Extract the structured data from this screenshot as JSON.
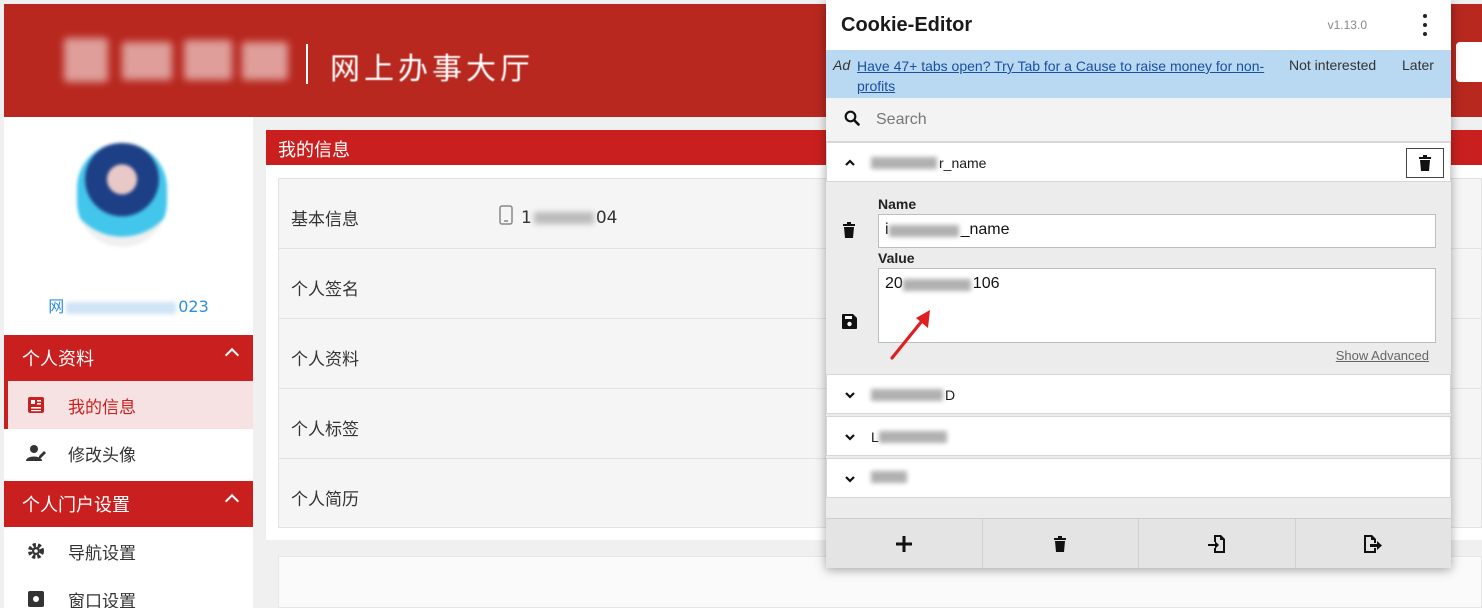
{
  "site": {
    "title": "网上办事大厅",
    "username_prefix": "网",
    "username_suffix": "023",
    "sidebar": {
      "group1": "个人资料",
      "item_my_info": "我的信息",
      "item_avatar": "修改头像",
      "group2": "个人门户设置",
      "item_nav": "导航设置",
      "item_window": "窗口设置"
    },
    "panel_title": "我的信息",
    "rows": {
      "basic": "基本信息",
      "phone_prefix": "1",
      "phone_suffix": "04",
      "signature": "个人签名",
      "profile": "个人资料",
      "tags": "个人标签",
      "resume": "个人简历"
    }
  },
  "cookie_editor": {
    "title": "Cookie-Editor",
    "version": "v1.13.0",
    "ad": {
      "tag": "Ad",
      "link": "Have 47+ tabs open? Try Tab for a Cause to raise money for non-profits",
      "not_interested": "Not interested",
      "later": "Later"
    },
    "search_placeholder": "Search",
    "expanded_cookie": {
      "row_name_suffix": "r_name",
      "name_label": "Name",
      "name_prefix": "i",
      "name_suffix": "_name",
      "value_label": "Value",
      "value_prefix": "20",
      "value_suffix": "106",
      "show_advanced": "Show Advanced"
    },
    "collapsed_cookies": [
      {
        "name_suffix": "D"
      },
      {
        "name_prefix": "L"
      },
      {
        "name_suffix": ""
      }
    ],
    "icons": {
      "search": "search-icon",
      "trash": "trash-icon",
      "save": "save-icon",
      "add": "add-icon",
      "import": "import-icon",
      "export": "export-icon"
    },
    "annotation_color": "#e02020"
  }
}
